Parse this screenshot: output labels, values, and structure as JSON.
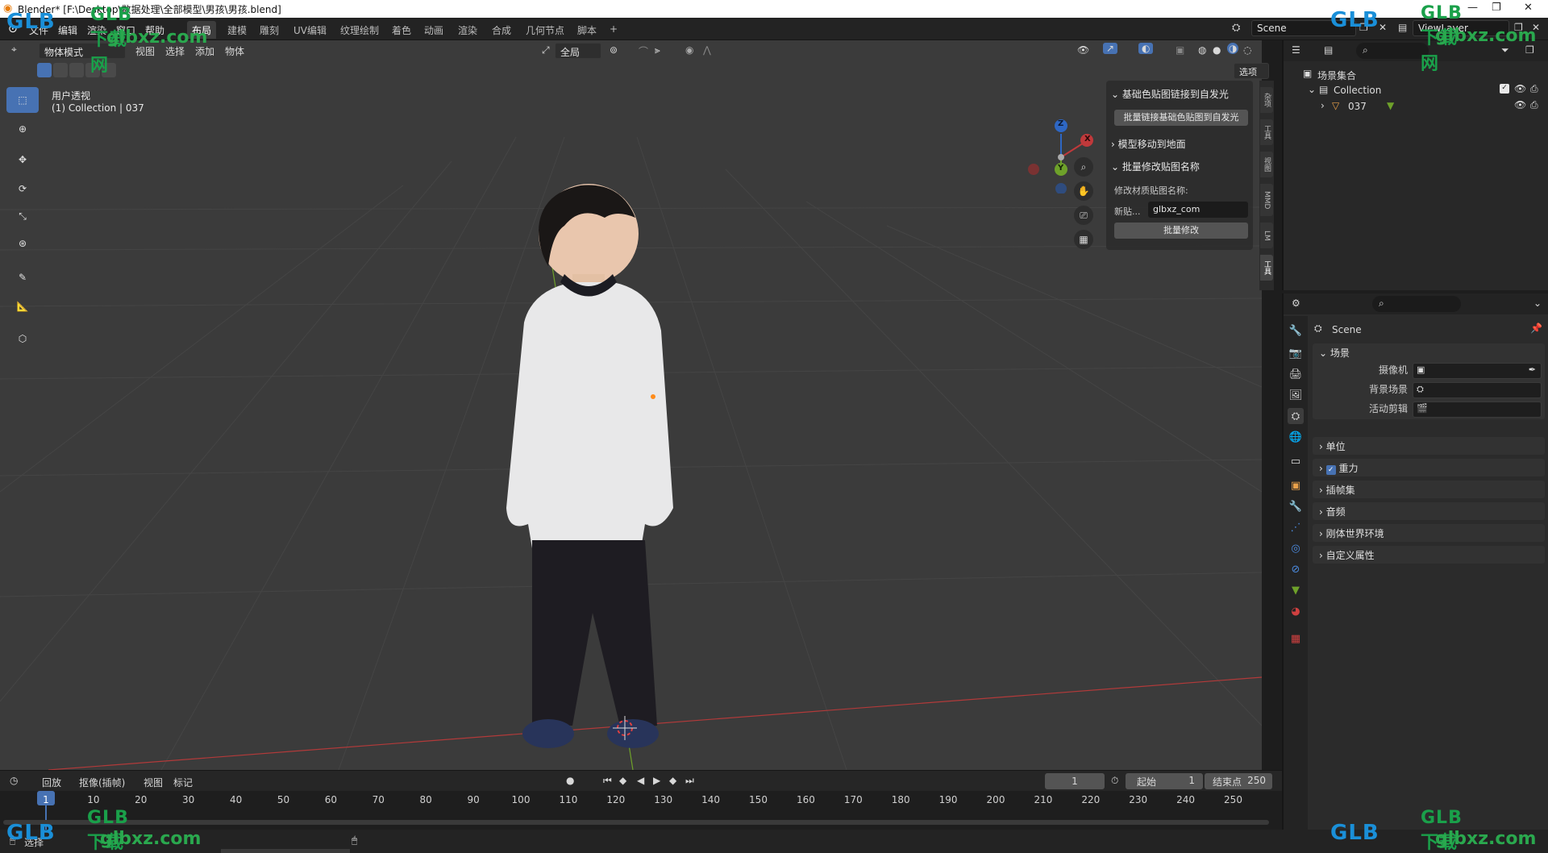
{
  "window": {
    "title": "Blender* [F:\\Desktop\\数据处理\\全部模型\\男孩\\男孩.blend]",
    "controls": [
      "—",
      "❐",
      "✕"
    ]
  },
  "topbar": {
    "menus": [
      "文件",
      "编辑",
      "渲染",
      "窗口",
      "帮助"
    ],
    "workspaces": [
      "布局",
      "建模",
      "雕刻",
      "UV编辑",
      "纹理绘制",
      "着色",
      "动画",
      "渲染",
      "合成",
      "几何节点",
      "脚本"
    ],
    "active_workspace": "布局",
    "add_workspace": "+",
    "scene": "Scene",
    "view_layer": "ViewLayer"
  },
  "viewport": {
    "mode": "物体模式",
    "menus": [
      "视图",
      "选择",
      "添加",
      "物体"
    ],
    "transform_orientation": "全局",
    "options_label": "选项",
    "view_label": "用户透视",
    "collection_label": "(1) Collection | 037",
    "gizmo": {
      "z": "Z",
      "y": "Y",
      "x": "X"
    }
  },
  "tools": [
    {
      "name": "select-box",
      "icon": "cursor-select-icon"
    },
    {
      "name": "cursor",
      "icon": "crosshair-cursor-icon"
    },
    {
      "name": "move",
      "icon": "move-arrows-icon"
    },
    {
      "name": "rotate",
      "icon": "rotate-icon"
    },
    {
      "name": "scale",
      "icon": "scale-icon"
    },
    {
      "name": "transform",
      "icon": "transform-icon"
    },
    {
      "name": "annotate",
      "icon": "pencil-icon"
    },
    {
      "name": "measure",
      "icon": "ruler-icon"
    },
    {
      "name": "add-cube",
      "icon": "cube-add-icon"
    }
  ],
  "npanel": {
    "sections": [
      {
        "label": "基础色贴图链接到自发光",
        "expanded": true,
        "button": "批量链接基础色贴图到自发光"
      },
      {
        "label": "模型移动到地面",
        "expanded": false
      },
      {
        "label": "批量修改贴图名称",
        "expanded": true
      }
    ],
    "rename_label": "修改材质贴图名称:",
    "new_label": "新贴...",
    "new_value": "glbxz_com",
    "batch_button": "批量修改",
    "tabs": [
      "杂项",
      "工具",
      "视图",
      "MMD",
      "LM",
      "工具"
    ]
  },
  "outliner": {
    "root": "场景集合",
    "collection": "Collection",
    "object": "037"
  },
  "properties": {
    "scene_name": "Scene",
    "section_scene": "场景",
    "camera_label": "摄像机",
    "background_label": "背景场景",
    "clip_label": "活动剪辑",
    "sections": [
      "单位",
      "重力",
      "插帧集",
      "音频",
      "刚体世界环境",
      "自定义属性"
    ],
    "gravity_checked": true
  },
  "timeline": {
    "menus": [
      "回放",
      "抠像(插帧)",
      "视图",
      "标记"
    ],
    "current_frame": "1",
    "start_label": "起始",
    "start": "1",
    "end_label": "结束点",
    "end": "250",
    "ruler": [
      "1",
      "10",
      "20",
      "30",
      "40",
      "50",
      "60",
      "70",
      "80",
      "90",
      "100",
      "110",
      "120",
      "130",
      "140",
      "150",
      "160",
      "170",
      "180",
      "190",
      "200",
      "210",
      "220",
      "230",
      "240",
      "250"
    ]
  },
  "statusbar": {
    "left": "选择"
  },
  "watermarks": {
    "brand": "GLB下载网",
    "url": "glbxz.com"
  },
  "colors": {
    "accent": "#4772b3",
    "viewport_bg": "#3b3b3b",
    "x_axis": "#c0393b",
    "y_axis": "#6ea12a",
    "z_axis": "#2e67c4",
    "watermark": "#1aa04a"
  }
}
